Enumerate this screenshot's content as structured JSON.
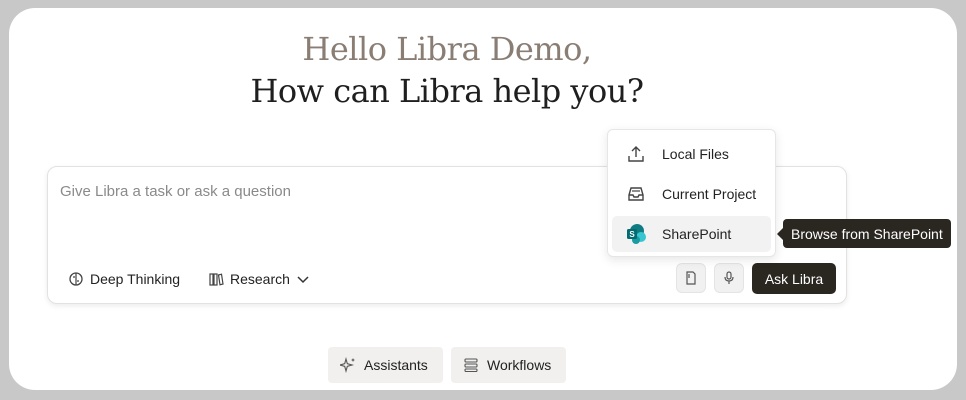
{
  "greeting": {
    "line1": "Hello Libra Demo,",
    "line2": "How can Libra help you?"
  },
  "composer": {
    "placeholder": "Give Libra a task or ask a question",
    "deep_thinking_label": "Deep Thinking",
    "research_label": "Research",
    "ask_button_label": "Ask Libra"
  },
  "upload_menu": {
    "items": [
      {
        "label": "Local Files",
        "icon": "upload-icon"
      },
      {
        "label": "Current Project",
        "icon": "inbox-tray-icon"
      },
      {
        "label": "SharePoint",
        "icon": "sharepoint-icon"
      }
    ],
    "tooltip": "Browse from SharePoint"
  },
  "bottom_links": {
    "assistants_label": "Assistants",
    "workflows_label": "Workflows"
  },
  "colors": {
    "greeting_muted": "#8a7d74",
    "dark_button": "#2a2620",
    "sharepoint_teal": "#0f7c84"
  }
}
